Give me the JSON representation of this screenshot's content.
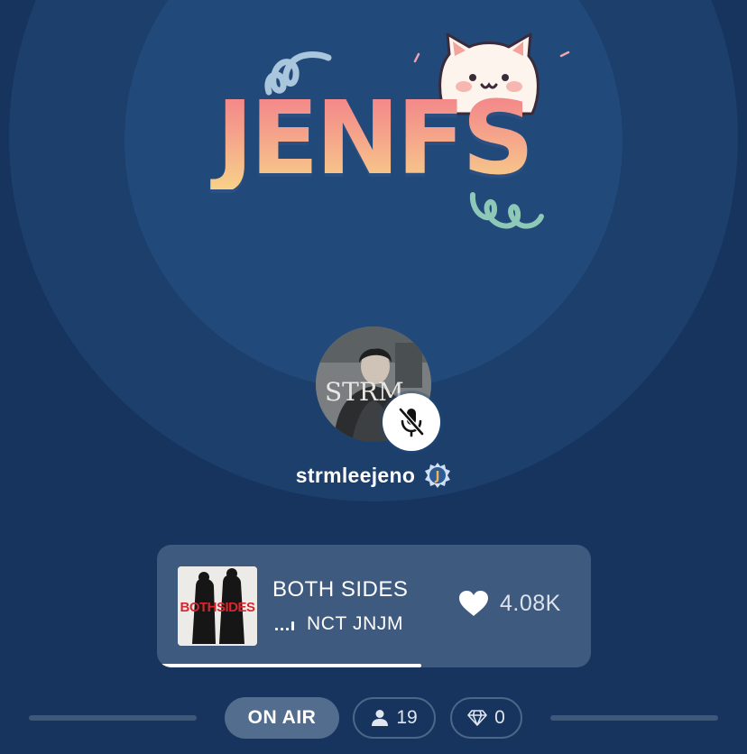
{
  "room": {
    "logo_text": "JENFS"
  },
  "host": {
    "username": "strmleejeno",
    "badge_letter": "J",
    "avatar_caption": "STRM",
    "mic_state": "muted",
    "icons": {
      "mute": "mic-off-icon",
      "badge": "j-badge-icon"
    }
  },
  "now_playing": {
    "title": "BOTH SIDES",
    "artist": "NCT JNJM",
    "likes": "4.08K",
    "cover_text": "BOTHSIDES",
    "progress_fraction": 0.61,
    "icons": {
      "equalizer": "equalizer-icon",
      "like": "heart-icon"
    }
  },
  "status_bar": {
    "on_air_label": "ON AIR",
    "listeners": "19",
    "gems": "0",
    "icons": {
      "listeners": "person-icon",
      "gems": "diamond-icon"
    }
  },
  "colors": {
    "background": "#17345e",
    "outer_ring": "#1c3f6c",
    "inner_ring": "#214a7b",
    "card": "#3f5a7f",
    "logo_gradient_top": "#f3808a",
    "logo_gradient_bottom": "#f7d189"
  }
}
